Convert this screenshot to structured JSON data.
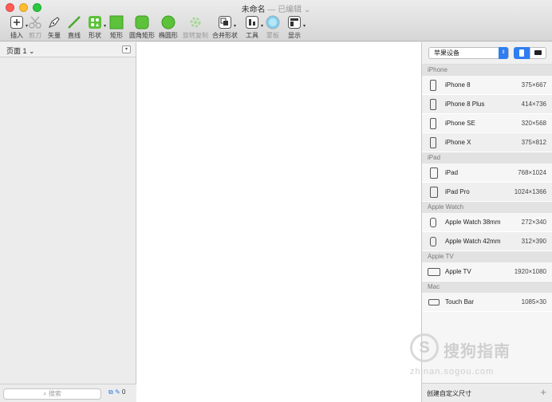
{
  "window": {
    "title": "未命名",
    "separator": "—",
    "status": "已编辑"
  },
  "toolbar": {
    "items": [
      {
        "label": "插入",
        "icon": "plus-icon"
      },
      {
        "label": "剪刀",
        "icon": "scissors-icon"
      },
      {
        "label": "矢量",
        "icon": "pen-icon"
      },
      {
        "label": "直线",
        "icon": "line-icon"
      },
      {
        "label": "形状",
        "icon": "shapes-icon"
      },
      {
        "label": "矩形",
        "icon": "rectangle-icon"
      },
      {
        "label": "圆角矩形",
        "icon": "rounded-rectangle-icon"
      },
      {
        "label": "椭圆形",
        "icon": "oval-icon"
      },
      {
        "label": "旋转复制",
        "icon": "rotate-copies-icon"
      },
      {
        "label": "合并形状",
        "icon": "combine-shapes-icon"
      },
      {
        "label": "工具",
        "icon": "tools-icon"
      },
      {
        "label": "蒙板",
        "icon": "mask-icon"
      },
      {
        "label": "显示",
        "icon": "view-icon"
      }
    ]
  },
  "pages": {
    "current": "页面 1",
    "chevron": "⌄"
  },
  "left_footer": {
    "search_placeholder": "搜索",
    "count": "0"
  },
  "right_panel": {
    "device_selector": "苹果设备",
    "groups": [
      {
        "name": "iPhone",
        "devices": [
          {
            "name": "iPhone 8",
            "size": "375×667",
            "icon": "phone-icon"
          },
          {
            "name": "iPhone 8 Plus",
            "size": "414×736",
            "icon": "phone-icon"
          },
          {
            "name": "iPhone SE",
            "size": "320×568",
            "icon": "phone-icon"
          },
          {
            "name": "iPhone X",
            "size": "375×812",
            "icon": "phone-icon"
          }
        ]
      },
      {
        "name": "iPad",
        "devices": [
          {
            "name": "iPad",
            "size": "768×1024",
            "icon": "tablet-icon"
          },
          {
            "name": "iPad Pro",
            "size": "1024×1366",
            "icon": "tablet-icon"
          }
        ]
      },
      {
        "name": "Apple Watch",
        "devices": [
          {
            "name": "Apple Watch 38mm",
            "size": "272×340",
            "icon": "watch-icon"
          },
          {
            "name": "Apple Watch 42mm",
            "size": "312×390",
            "icon": "watch-icon"
          }
        ]
      },
      {
        "name": "Apple TV",
        "devices": [
          {
            "name": "Apple TV",
            "size": "1920×1080",
            "icon": "tv-icon"
          }
        ]
      },
      {
        "name": "Mac",
        "devices": [
          {
            "name": "Touch Bar",
            "size": "1085×30",
            "icon": "touchbar-icon"
          }
        ]
      }
    ],
    "footer_label": "创建自定义尺寸",
    "add_symbol": "+"
  },
  "watermark": {
    "logo_letter": "S",
    "brand": "搜狗指南",
    "url": "zhinan.sogou.com"
  },
  "colors": {
    "accent": "#2f7ef0",
    "shape_green": "#5cc23a",
    "canvas": "#ffffff"
  }
}
